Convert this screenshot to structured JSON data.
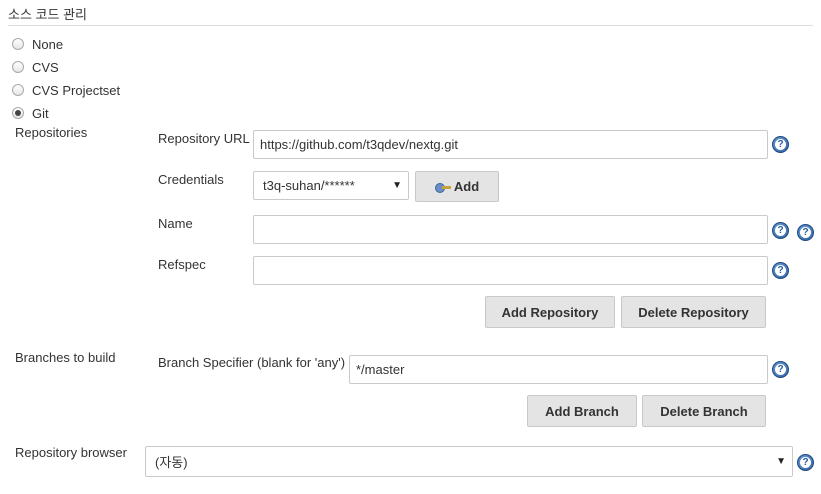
{
  "section": {
    "title": "소스 코드 관리"
  },
  "scm_options": [
    {
      "label": "None",
      "checked": false
    },
    {
      "label": "CVS",
      "checked": false
    },
    {
      "label": "CVS Projectset",
      "checked": false
    },
    {
      "label": "Git",
      "checked": true
    }
  ],
  "repositories": {
    "label": "Repositories",
    "url_label": "Repository URL",
    "url_value": "https://github.com/t3qdev/nextg.git",
    "credentials_label": "Credentials",
    "credentials_value": "t3q-suhan/******",
    "add_label": "Add",
    "name_label": "Name",
    "name_value": "",
    "refspec_label": "Refspec",
    "refspec_value": "",
    "add_repository_label": "Add Repository",
    "delete_repository_label": "Delete Repository"
  },
  "branches": {
    "label": "Branches to build",
    "specifier_label": "Branch Specifier (blank for 'any')",
    "specifier_value": "*/master",
    "add_branch_label": "Add Branch",
    "delete_branch_label": "Delete Branch"
  },
  "repo_browser": {
    "label": "Repository browser",
    "value": "(자동)"
  },
  "help_glyph": "?",
  "colors": {
    "help_blue": "#2c5f9e",
    "button_bg": "#e4e4e4",
    "border": "#c9c9c9"
  }
}
